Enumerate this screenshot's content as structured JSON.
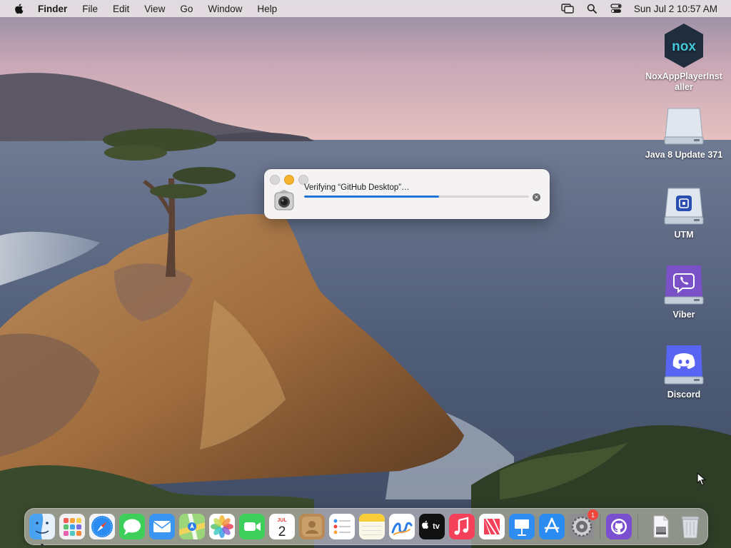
{
  "menubar": {
    "app_name": "Finder",
    "menus": [
      "File",
      "Edit",
      "View",
      "Go",
      "Window",
      "Help"
    ],
    "clock": "Sun Jul 2  10:57 AM",
    "status_icons": [
      "screen-mirroring-icon",
      "spotlight-search-icon",
      "control-center-icon"
    ]
  },
  "desktop": {
    "items": [
      {
        "label": "NoxAppPlayerInstaller",
        "icon": "nox-app-icon",
        "icon_text": "nox"
      },
      {
        "label": "Java 8 Update 371",
        "icon": "disk-image-icon"
      },
      {
        "label": "UTM",
        "icon": "utm-disk-icon"
      },
      {
        "label": "Viber",
        "icon": "viber-disk-icon"
      },
      {
        "label": "Discord",
        "icon": "discord-disk-icon"
      }
    ]
  },
  "dialog": {
    "message": "Verifying “GitHub Desktop”…",
    "progress": 0.6
  },
  "dock": {
    "items": [
      {
        "name": "Finder",
        "icon": "finder-icon"
      },
      {
        "name": "Launchpad",
        "icon": "launchpad-icon"
      },
      {
        "name": "Safari",
        "icon": "safari-icon"
      },
      {
        "name": "Messages",
        "icon": "messages-icon"
      },
      {
        "name": "Mail",
        "icon": "mail-icon"
      },
      {
        "name": "Maps",
        "icon": "maps-icon"
      },
      {
        "name": "Photos",
        "icon": "photos-icon"
      },
      {
        "name": "FaceTime",
        "icon": "facetime-icon"
      },
      {
        "name": "Calendar",
        "icon": "calendar-icon",
        "month": "JUL",
        "day": "2"
      },
      {
        "name": "Contacts",
        "icon": "contacts-icon"
      },
      {
        "name": "Reminders",
        "icon": "reminders-icon"
      },
      {
        "name": "Notes",
        "icon": "notes-icon"
      },
      {
        "name": "Freeform",
        "icon": "freeform-icon"
      },
      {
        "name": "TV",
        "icon": "apple-tv-icon",
        "text": "tv"
      },
      {
        "name": "Music",
        "icon": "music-icon"
      },
      {
        "name": "News",
        "icon": "news-icon"
      },
      {
        "name": "Keynote",
        "icon": "keynote-icon"
      },
      {
        "name": "App Store",
        "icon": "app-store-icon"
      },
      {
        "name": "System Settings",
        "icon": "system-settings-icon",
        "badge": "1"
      },
      {
        "name": "GitHub Desktop",
        "icon": "github-desktop-icon"
      },
      {
        "name": "Downloads",
        "icon": "downloads-stack-icon"
      },
      {
        "name": "Trash",
        "icon": "trash-icon"
      }
    ]
  }
}
